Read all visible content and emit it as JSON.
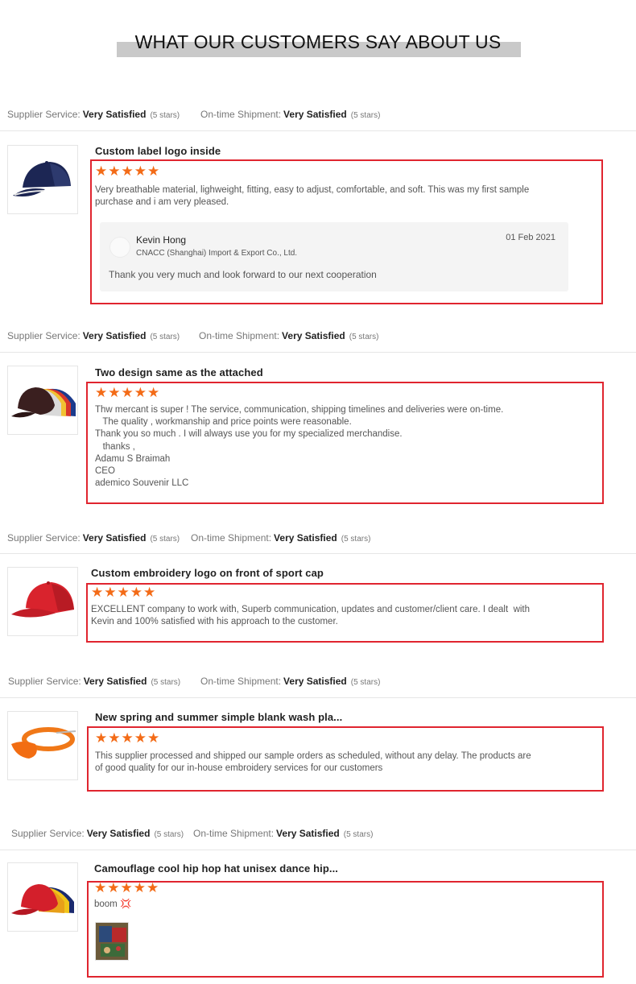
{
  "header": {
    "title": "WHAT OUR CUSTOMERS SAY ABOUT US"
  },
  "ratings": [
    {
      "supplier_label": "Supplier Service:",
      "supplier_value": "Very Satisfied",
      "supplier_note": "(5 stars)",
      "shipment_label": "On-time Shipment:",
      "shipment_value": "Very Satisfied",
      "shipment_note": "(5 stars)"
    },
    {
      "supplier_label": "Supplier Service:",
      "supplier_value": "Very Satisfied",
      "supplier_note": "(5 stars)",
      "shipment_label": "On-time Shipment:",
      "shipment_value": "Very Satisfied",
      "shipment_note": "(5 stars)"
    },
    {
      "supplier_label": "Supplier Service:",
      "supplier_value": "Very Satisfied",
      "supplier_note": "(5 stars)",
      "shipment_label": "On-time Shipment:",
      "shipment_value": "Very Satisfied",
      "shipment_note": "(5 stars)"
    },
    {
      "supplier_label": "Supplier Service:",
      "supplier_value": "Very Satisfied",
      "supplier_note": "(5 stars)",
      "shipment_label": "On-time Shipment:",
      "shipment_value": "Very Satisfied",
      "shipment_note": "(5 stars)"
    },
    {
      "supplier_label": "Supplier Service:",
      "supplier_value": "Very Satisfied",
      "supplier_note": "(5 stars)",
      "shipment_label": "On-time Shipment:",
      "shipment_value": "Very Satisfied",
      "shipment_note": "(5 stars)"
    }
  ],
  "reviews": [
    {
      "product_title": "Custom label logo inside",
      "stars": "★★★★★",
      "text": "Very breathable material, lighweight, fitting, easy to adjust, comfortable, and soft. This was my first sample\npurchase and i am very pleased.",
      "reply": {
        "name": "Kevin Hong",
        "company": "CNACC (Shanghai) Import & Export Co., Ltd.",
        "date": "01 Feb 2021",
        "text": "Thank you very much and look forward to our next cooperation"
      }
    },
    {
      "product_title": "Two design same as the attached",
      "stars": "★★★★★",
      "text": "Thw mercant is super ! The service, communication, shipping timelines and deliveries were on-time.\n   The quality , workmanship and price points were reasonable.\nThank you so much . I will always use you for my specialized merchandise.\n   thanks ,\nAdamu S Braimah\nCEO\nademico Souvenir LLC"
    },
    {
      "product_title": "Custom embroidery logo on front of sport cap",
      "stars": "★★★★★",
      "text": "EXCELLENT company to work with, Superb communication, updates and customer/client care. I dealt  with\nKevin and 100% satisfied with his approach to the customer."
    },
    {
      "product_title": "New spring and summer simple blank wash pla...",
      "stars": "★★★★★",
      "text": "This supplier processed and shipped our sample orders as scheduled, without any delay. The products are\nof good quality for our in-house embroidery services for our customers"
    },
    {
      "product_title": "Camouflage cool hip hop hat unisex dance hip...",
      "stars": "★★★★★",
      "text": "boom 💢"
    }
  ],
  "colors": {
    "star": "#f36b17",
    "highlight_box": "#e0252f",
    "title_bar": "#c9c9c9"
  }
}
